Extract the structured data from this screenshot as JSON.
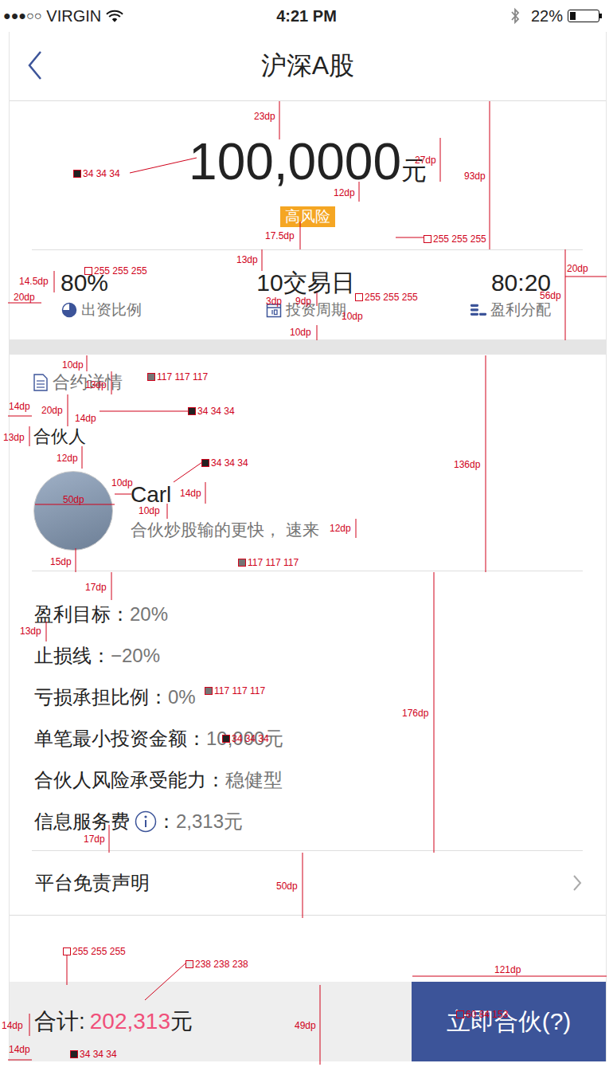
{
  "status_bar": {
    "signal": "●●●○○",
    "carrier": "VIRGIN",
    "time": "4:21 PM",
    "battery": "22%",
    "battery_level": 0.22
  },
  "nav": {
    "title": "沪深A股"
  },
  "amount": {
    "value": "100,0000",
    "unit": "元",
    "risk_badge": "高风险"
  },
  "stats": [
    {
      "value": "80%",
      "label": "出资比例",
      "kind": "ratio"
    },
    {
      "value": "10交易日",
      "label": "投资周期",
      "kind": "period"
    },
    {
      "value": "80:20",
      "label": "盈利分配",
      "kind": "split"
    }
  ],
  "contract": {
    "heading": "合约详情",
    "partner_heading": "合伙人",
    "partner": {
      "name": "Carl",
      "motto": "合伙炒股输的更快， 速来"
    }
  },
  "details": [
    {
      "label": "盈利目标",
      "separator": "：",
      "value": "20%",
      "kind": "plain"
    },
    {
      "label": "止损线",
      "separator": "：",
      "value": "−20%",
      "kind": "plain"
    },
    {
      "label": "亏损承担比例",
      "separator": "：",
      "value": "0%",
      "kind": "plain"
    },
    {
      "label": "单笔最小投资金额",
      "separator": "：",
      "value": "10,000元",
      "kind": "plain"
    },
    {
      "label": "合伙人风险承受能力",
      "separator": "：",
      "value": "稳健型",
      "kind": "plain"
    },
    {
      "label": "信息服务费",
      "separator": "：",
      "value": "2,313元",
      "kind": "info"
    }
  ],
  "disclaimer": "平台免责声明",
  "footer": {
    "total_label": "合计:",
    "total_value": "202,313",
    "total_unit": "元",
    "button": "立即合伙(?)"
  },
  "annotations": [
    {
      "text": "23dp",
      "kind": "dimension"
    },
    {
      "text": "34 34 34",
      "kind": "swatch",
      "color": "#222222"
    },
    {
      "text": "27dp",
      "kind": "dimension"
    },
    {
      "text": "93dp",
      "kind": "dimension"
    },
    {
      "text": "12dp",
      "kind": "dimension"
    },
    {
      "text": "255 255 255",
      "kind": "swatch",
      "color": "#ffffff"
    },
    {
      "text": "17.5dp",
      "kind": "dimension"
    },
    {
      "text": "13dp",
      "kind": "dimension"
    },
    {
      "text": "14.5dp",
      "kind": "dimension"
    },
    {
      "text": "255 255 255",
      "kind": "swatch",
      "color": "#ffffff"
    },
    {
      "text": "20dp",
      "kind": "dimension"
    },
    {
      "text": "56dp",
      "kind": "dimension"
    },
    {
      "text": "20dp",
      "kind": "dimension"
    },
    {
      "text": "3dp",
      "kind": "dimension"
    },
    {
      "text": "9dp",
      "kind": "dimension"
    },
    {
      "text": "255 255 255",
      "kind": "swatch",
      "color": "#ffffff"
    },
    {
      "text": "10dp",
      "kind": "dimension"
    },
    {
      "text": "10dp",
      "kind": "dimension"
    },
    {
      "text": "10dp",
      "kind": "dimension"
    },
    {
      "text": "13dp",
      "kind": "dimension"
    },
    {
      "text": "117 117 117",
      "kind": "swatch",
      "color": "#757575"
    },
    {
      "text": "20dp",
      "kind": "dimension"
    },
    {
      "text": "14dp",
      "kind": "dimension"
    },
    {
      "text": "14dp",
      "kind": "dimension"
    },
    {
      "text": "34 34 34",
      "kind": "swatch",
      "color": "#222222"
    },
    {
      "text": "13dp",
      "kind": "dimension"
    },
    {
      "text": "12dp",
      "kind": "dimension"
    },
    {
      "text": "34 34 34",
      "kind": "swatch",
      "color": "#222222"
    },
    {
      "text": "10dp",
      "kind": "dimension"
    },
    {
      "text": "50dp",
      "kind": "dimension"
    },
    {
      "text": "14dp",
      "kind": "dimension"
    },
    {
      "text": "10dp",
      "kind": "dimension"
    },
    {
      "text": "12dp",
      "kind": "dimension"
    },
    {
      "text": "136dp",
      "kind": "dimension"
    },
    {
      "text": "15dp",
      "kind": "dimension"
    },
    {
      "text": "117 117 117",
      "kind": "swatch",
      "color": "#757575"
    },
    {
      "text": "17dp",
      "kind": "dimension"
    },
    {
      "text": "13dp",
      "kind": "dimension"
    },
    {
      "text": "117 117 117",
      "kind": "swatch",
      "color": "#757575"
    },
    {
      "text": "34 34 34",
      "kind": "swatch",
      "color": "#222222"
    },
    {
      "text": "176dp",
      "kind": "dimension"
    },
    {
      "text": "17dp",
      "kind": "dimension"
    },
    {
      "text": "50dp",
      "kind": "dimension"
    },
    {
      "text": "255 255 255",
      "kind": "swatch",
      "color": "#ffffff"
    },
    {
      "text": "238 238 238",
      "kind": "swatch",
      "color": "#eeeeee"
    },
    {
      "text": "121dp",
      "kind": "dimension"
    },
    {
      "text": "60 84 153",
      "kind": "swatch",
      "color": "#3c5499"
    },
    {
      "text": "14dp",
      "kind": "dimension"
    },
    {
      "text": "49dp",
      "kind": "dimension"
    },
    {
      "text": "14dp",
      "kind": "dimension"
    },
    {
      "text": "34 34 34",
      "kind": "swatch",
      "color": "#222222"
    }
  ]
}
